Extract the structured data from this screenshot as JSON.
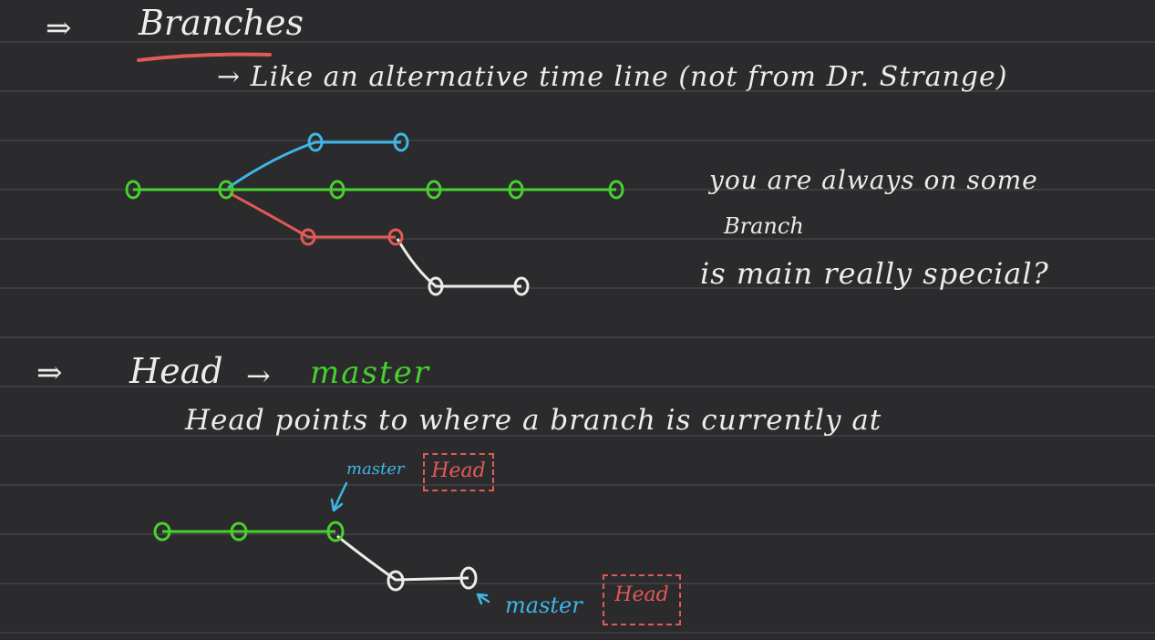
{
  "arrow_glyph": "⇒",
  "section1": {
    "title": "Branches",
    "note_line": "→ Like an alternative  time line  (not from Dr. Strange)",
    "side_notes": [
      "you are always on some",
      "Branch",
      "is main really special?"
    ]
  },
  "section2": {
    "title": "Head",
    "pointer_arrow": "→",
    "branch_name": "master",
    "description": "Head points to where a branch is currently at",
    "label_master_top": "master",
    "label_head_top": "Head",
    "label_master_bottom": "master",
    "label_head_bottom": "Head"
  },
  "colors": {
    "background": "#2b2b2d",
    "ink_white": "#ecece8",
    "green": "#48d02e",
    "cyan": "#3db7e6",
    "red": "#e25a55"
  }
}
